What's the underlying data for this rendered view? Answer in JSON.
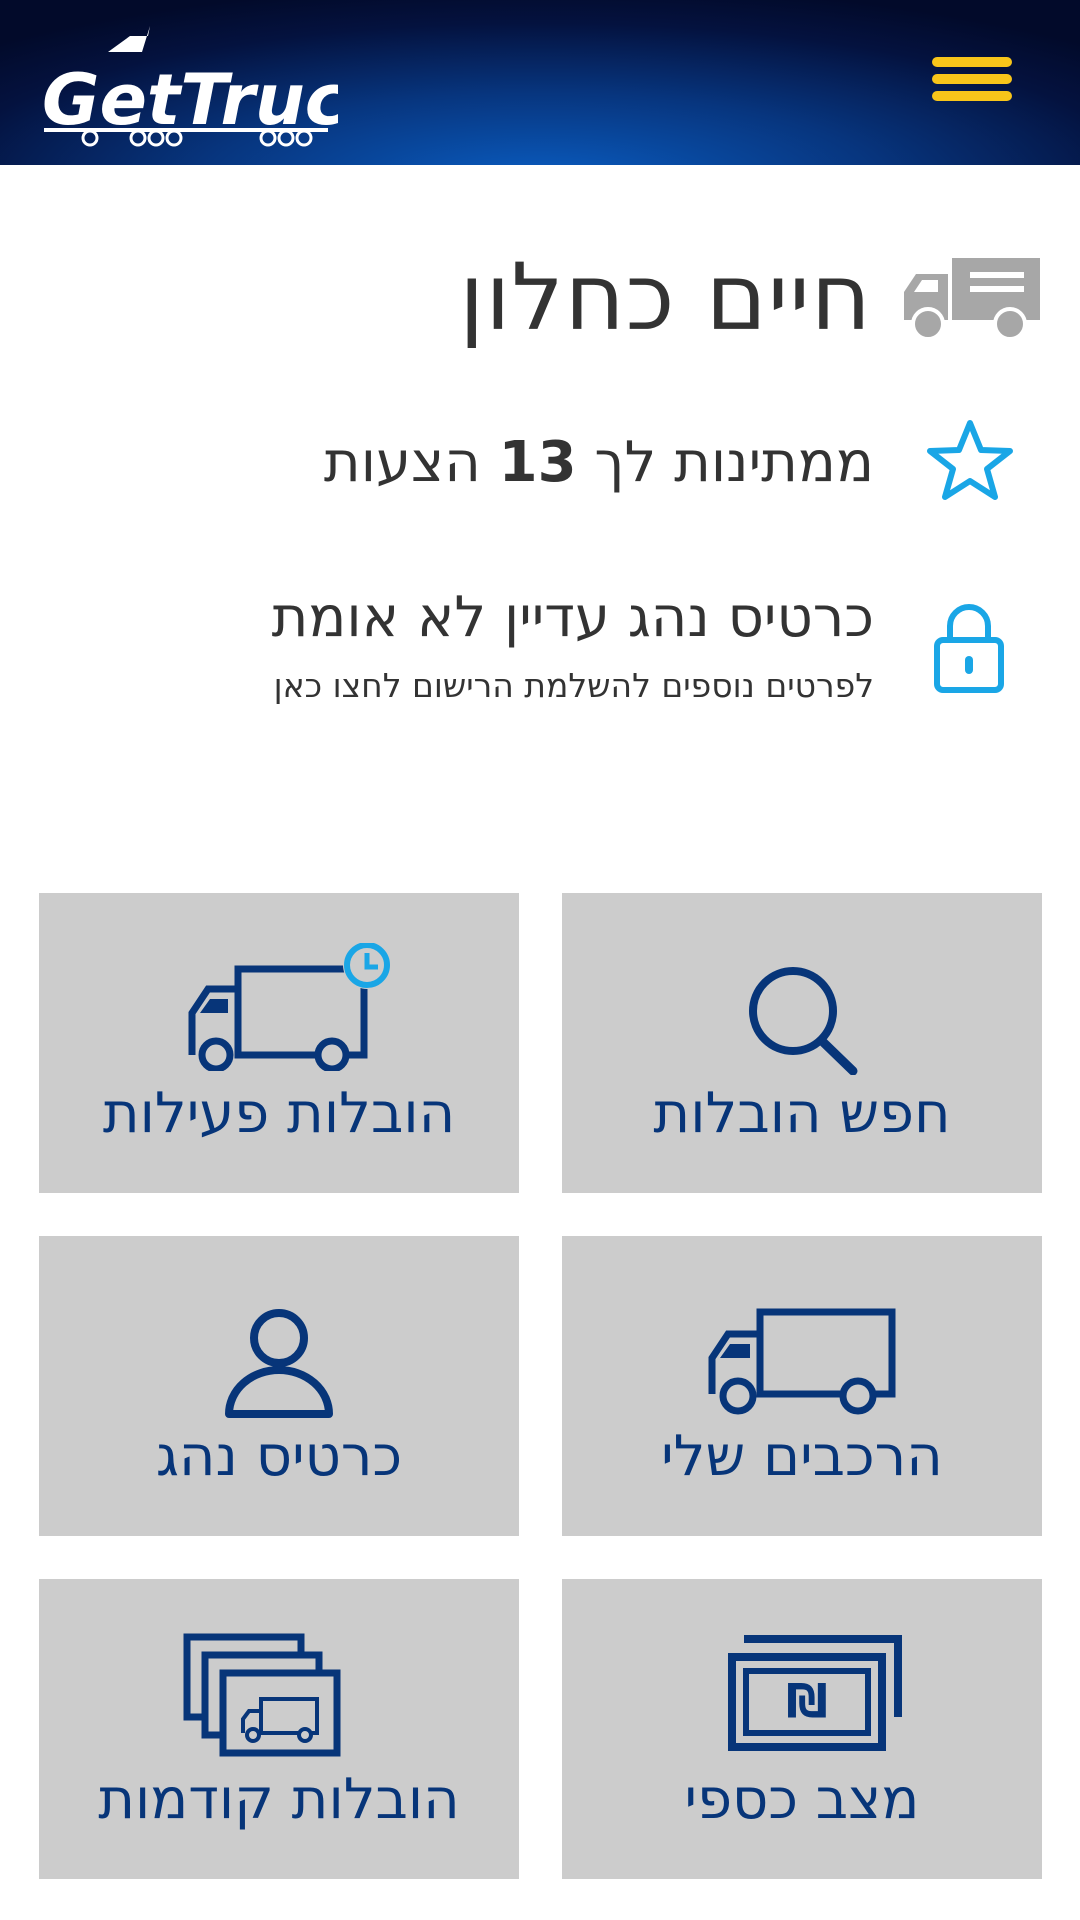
{
  "header": {
    "logo_text": "GetTruck",
    "menu_icon": "hamburger-menu-icon"
  },
  "profile": {
    "name": "חיים כחלון",
    "name_icon": "truck-icon",
    "offers_prefix": "ממתינות לך",
    "offers_count": "13",
    "offers_suffix": "הצעות",
    "offers_icon": "star-icon",
    "card_status": "כרטיס נהג עדיין לא אומת",
    "card_hint": "לפרטים נוספים להשלמת הרישום לחצו כאן",
    "card_icon": "lock-icon"
  },
  "tiles": [
    {
      "label": "חפש הובלות",
      "icon": "search-icon"
    },
    {
      "label": "הובלות פעילות",
      "icon": "truck-clock-icon"
    },
    {
      "label": "הרכבים שלי",
      "icon": "truck-icon"
    },
    {
      "label": "כרטיס נהג",
      "icon": "user-icon"
    },
    {
      "label": "מצב כספי",
      "icon": "shekel-bills-icon"
    },
    {
      "label": "הובלות קודמות",
      "icon": "stacked-truck-cards-icon"
    }
  ],
  "colors": {
    "header_dark": "#020a2a",
    "header_accent": "#0a5cc0",
    "menu_yellow": "#f8c51a",
    "tile_bg": "#cccccc",
    "tile_fg": "#073579",
    "accent_blue": "#1aa6e6",
    "icon_gray": "#a7a7a7"
  }
}
